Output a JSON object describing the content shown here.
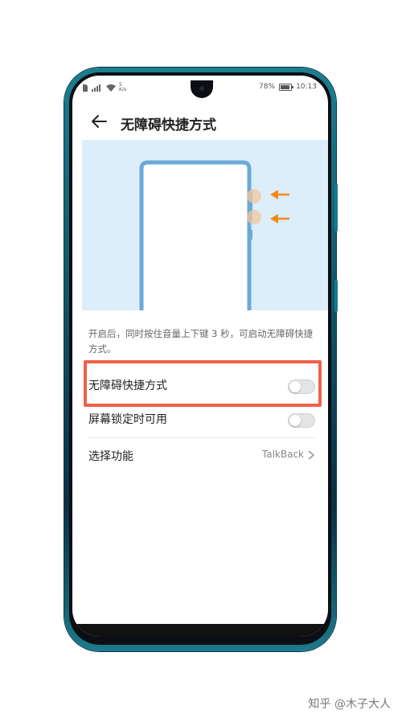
{
  "status_bar": {
    "left_icons": [
      "sim-icon",
      "signal-icon",
      "wifi-icon"
    ],
    "speed": "5\nK/s",
    "battery": "78%",
    "battery_level": 0.78,
    "time": "10:13"
  },
  "header": {
    "back_icon": "back-arrow-icon",
    "title": "无障碍快捷方式"
  },
  "illustration": {
    "description": "phone-volume-buttons-illustration",
    "arrow_color": "#f28a1f",
    "phone_outline_color": "#6aa9d8"
  },
  "description": "开启后，同时按住音量上下键 3 秒，可启动无障碍快捷方式。",
  "settings": [
    {
      "label": "无障碍快捷方式",
      "type": "toggle",
      "on": false
    },
    {
      "label": "屏幕锁定时可用",
      "type": "toggle",
      "on": false
    },
    {
      "label": "选择功能",
      "type": "link",
      "value": "TalkBack"
    }
  ],
  "highlight_color": "#ef6149",
  "watermark": "知乎 @木子大人"
}
